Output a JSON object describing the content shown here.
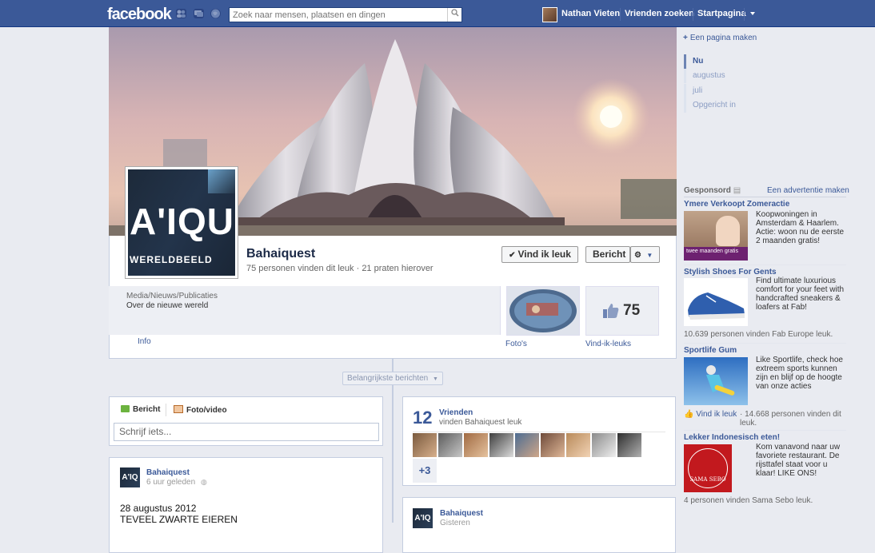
{
  "topbar": {
    "logo": "facebook",
    "search_placeholder": "Zoek naar mensen, plaatsen en dingen",
    "user_name": "Nathan Vieten",
    "find_friends": "Vrienden zoeken",
    "home": "Startpagina",
    "icons": [
      "friend-requests-icon",
      "messages-icon",
      "notifications-icon",
      "search-icon",
      "account-menu-icon"
    ]
  },
  "profile": {
    "name": "Bahaiquest",
    "stats": "75 personen vinden dit leuk · 21 praten hierover",
    "pic_text_big": "A'IQU",
    "pic_text_small": "WERELDBEELD",
    "like_button": "Vind ik leuk",
    "message_button": "Bericht",
    "category": "Media/Nieuws/Publicaties",
    "about": "Over de nieuwe wereld",
    "info_link": "Info",
    "photos_label": "Foto's",
    "likes_label": "Vind-ik-leuks",
    "likes_count": "75"
  },
  "timeline": {
    "highlights": "Belangrijkste berichten",
    "composer": {
      "status_tab": "Bericht",
      "photo_tab": "Foto/video",
      "placeholder": "Schrijf iets..."
    },
    "post1": {
      "author": "Bahaiquest",
      "time": "6 uur geleden",
      "line1": "28 augustus 2012",
      "line2": "TEVEEL ZWARTE EIEREN"
    },
    "friends": {
      "count": "12",
      "label": "Vrienden",
      "sub": "vinden Bahaiquest leuk",
      "more": "+3"
    },
    "post2": {
      "author": "Bahaiquest",
      "time": "Gisteren"
    }
  },
  "sidebar": {
    "create_page": "Een pagina maken",
    "years": [
      "Nu",
      "augustus",
      "juli",
      "Opgericht in"
    ],
    "sponsored": "Gesponsord",
    "create_ad": "Een advertentie maken",
    "ads": [
      {
        "title": "Ymere Verkoopt Zomeractie",
        "text": "Koopwoningen in Amsterdam & Haarlem. Actie: woon nu de eerste 2 maanden gratis!",
        "banner_text": "twee maanden gratis",
        "meta": ""
      },
      {
        "title": "Stylish Shoes For Gents",
        "text": "Find ultimate luxurious comfort for your feet with handcrafted sneakers & loafers at Fab!",
        "meta": "10.639 personen vinden Fab Europe leuk."
      },
      {
        "title": "Sportlife Gum",
        "text": "Like Sportlife, check hoe extreem sports kunnen zijn en blijf op de hoogte van onze acties",
        "like": "Vind ik leuk",
        "meta": "· 14.668 personen vinden dit leuk."
      },
      {
        "title": "Lekker Indonesisch eten!",
        "text": "Kom vanavond naar uw favoriete restaurant. De rijsttafel staat voor u klaar! LIKE ONS!",
        "logo_text": "SAMA SEBO",
        "meta": "4 personen vinden Sama Sebo leuk."
      }
    ]
  },
  "colors": {
    "brand": "#3b5998",
    "link": "#3b5998",
    "background": "#e9ebf1"
  }
}
